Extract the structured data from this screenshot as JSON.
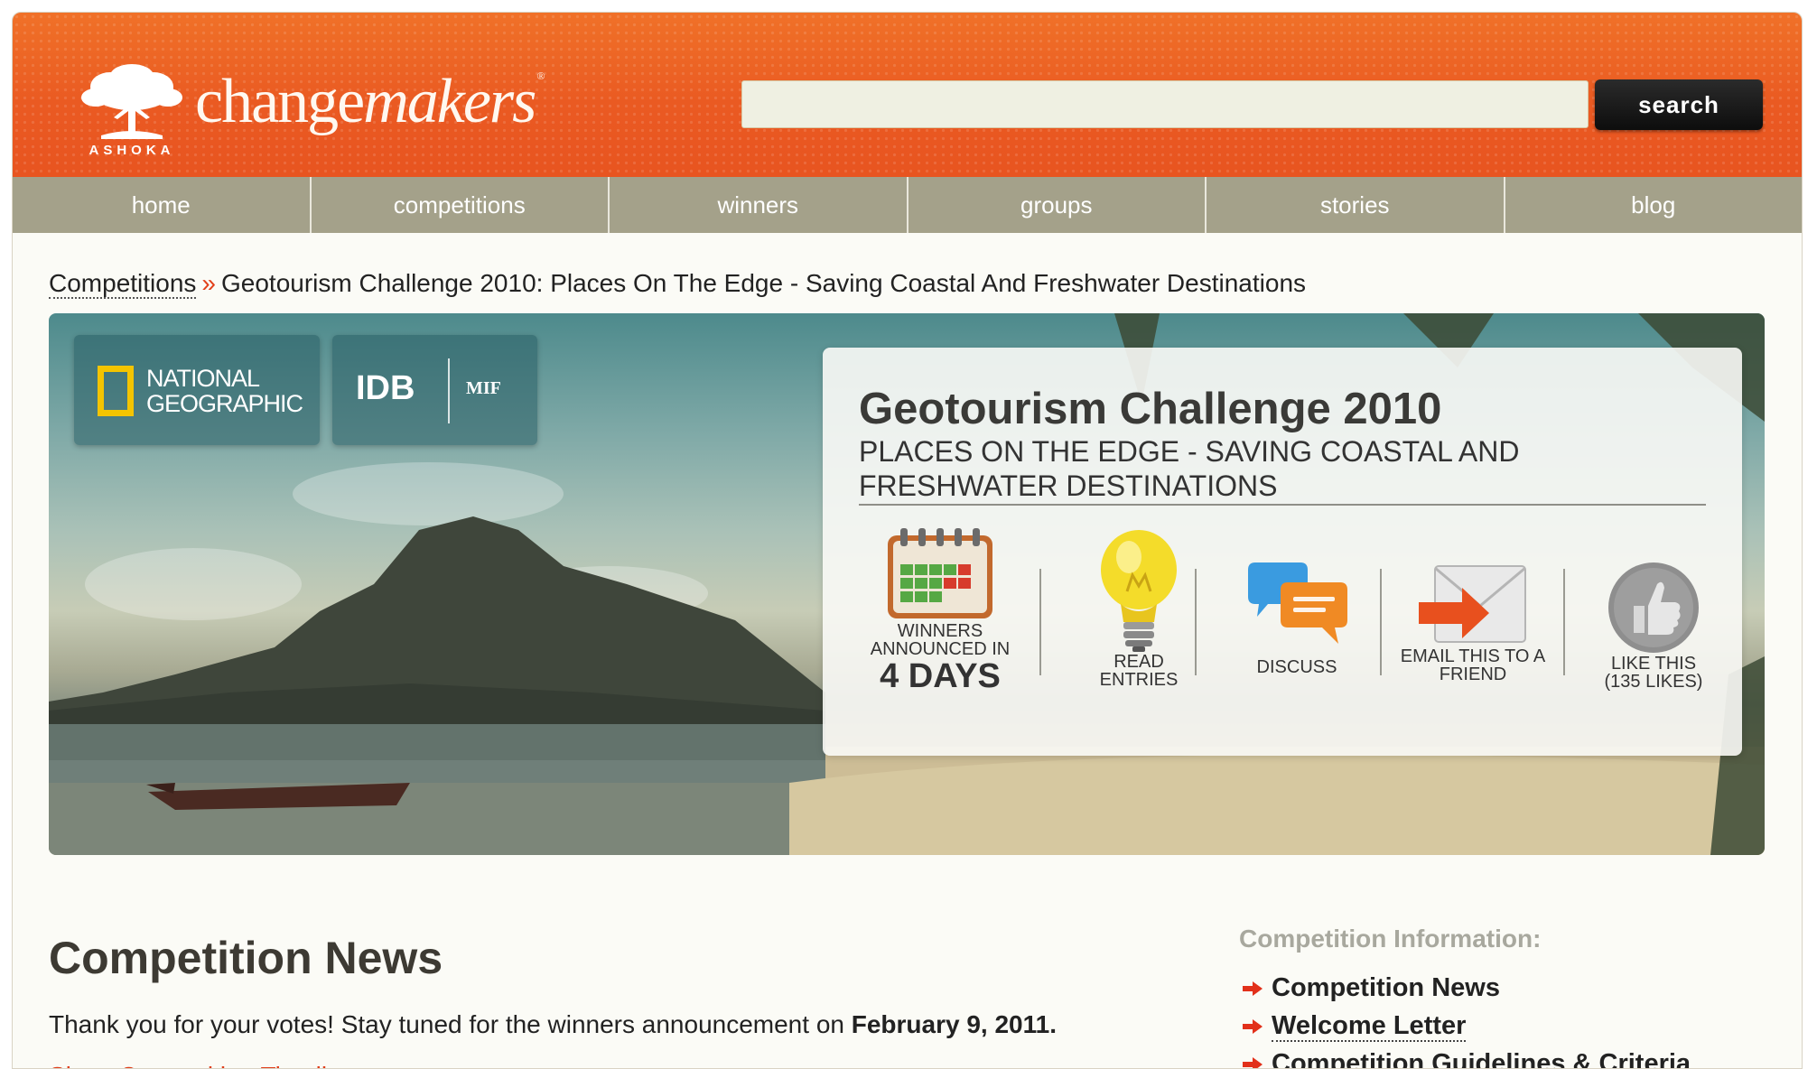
{
  "header": {
    "logo_text": "ASHOKA",
    "brand_part1": "change",
    "brand_part2": "makers",
    "brand_mark": "®",
    "search": {
      "value": "",
      "placeholder": ""
    },
    "search_button_label": "search"
  },
  "nav": {
    "items": [
      {
        "label": "home"
      },
      {
        "label": "competitions"
      },
      {
        "label": "winners"
      },
      {
        "label": "groups"
      },
      {
        "label": "stories"
      },
      {
        "label": "blog"
      }
    ]
  },
  "breadcrumb": {
    "parent": "Competitions",
    "separator": "»",
    "current": "Geotourism Challenge 2010: Places On The Edge - Saving Coastal And Freshwater Destinations"
  },
  "hero": {
    "sponsors": {
      "natgeo_line1": "NATIONAL",
      "natgeo_line2": "GEOGRAPHIC",
      "idb": "IDB",
      "mif": "MIF"
    },
    "card": {
      "title": "Geotourism Challenge 2010",
      "subtitle": "PLACES ON THE EDGE - SAVING COASTAL AND FRESHWATER DESTINATIONS",
      "actions": {
        "winners_line1": "WINNERS",
        "winners_line2": "ANNOUNCED IN",
        "winners_days": "4 DAYS",
        "read_line1": "READ",
        "read_line2": "ENTRIES",
        "discuss": "DISCUSS",
        "email_line1": "EMAIL THIS TO A",
        "email_line2": "FRIEND",
        "like_line1": "LIKE THIS",
        "like_line2": "(135 LIKES)"
      }
    }
  },
  "news": {
    "title": "Competition News",
    "text_before": "Thank you for your votes! Stay tuned for the winners announcement on ",
    "text_date": "February 9, 2011.",
    "timeline_link": "Show Competition Timeline >"
  },
  "sidebar": {
    "title": "Competition Information:",
    "links": [
      {
        "label": "Competition News"
      },
      {
        "label": "Welcome Letter"
      },
      {
        "label": "Competition Guidelines & Criteria"
      }
    ]
  },
  "colors": {
    "header_orange": "#e85420",
    "nav_bg": "#a4a18a",
    "link_red": "#e03c17",
    "arrow_red": "#e2301a"
  }
}
